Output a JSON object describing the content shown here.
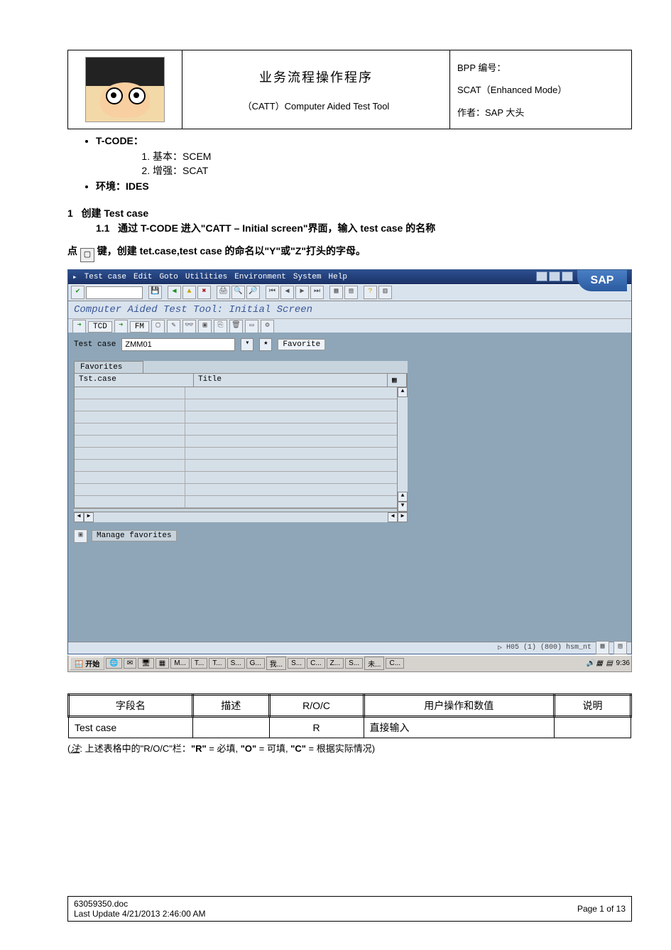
{
  "header": {
    "title_cn": "业务流程操作程序",
    "title_en": "（CATT）Computer Aided Test Tool",
    "bpp_label": "BPP 编号：",
    "scat": "SCAT（Enhanced Mode）",
    "author": "作者：SAP 大头"
  },
  "bullets": {
    "tcode": "T-CODE：",
    "tcode_items": [
      "基本：SCEM",
      "增强：SCAT"
    ],
    "env": "环境：IDES"
  },
  "section": {
    "num": "1",
    "title": "创建 Test case",
    "sub_num": "1.1",
    "sub_text": "通过 T-CODE 进入\"CATT – Initial screen\"界面，输入 test case 的名称",
    "para_before": "点",
    "para_after": "键，创建 tet.case,test case 的命名以\"Y\"或\"Z\"打头的字母。"
  },
  "sap": {
    "menu": [
      "Test case",
      "Edit",
      "Goto",
      "Utilities",
      "Environment",
      "System",
      "Help"
    ],
    "logo": "SAP",
    "screen_title": "Computer Aided Test Tool: Initial Screen",
    "tb2": [
      "TCD",
      "FM"
    ],
    "tc_label": "Test case",
    "tc_value": "ZMM01",
    "fav_btn": "Favorite",
    "fav_label": "Favorites",
    "col1": "Tst.case",
    "col2": "Title",
    "manage": "Manage favorites",
    "status": "H05 (1) (800)   hsm_nt",
    "taskbar_start": "开始",
    "taskbar_items": [
      "M...",
      "T...",
      "T...",
      "S...",
      "G...",
      "我...",
      "S...",
      "C...",
      "Z...",
      "S...",
      "未...",
      "C..."
    ],
    "clock": "9:36"
  },
  "table": {
    "h": [
      "字段名",
      "描述",
      "R/O/C",
      "用户操作和数值",
      "说明"
    ],
    "row": [
      "Test case",
      "",
      "R",
      "直接输入",
      ""
    ]
  },
  "note": "(注：上述表格中的\"R/O/C\"栏：\"R\" = 必填, \"O\" = 可填, \"C\" = 根据实际情况)",
  "footer": {
    "file": "63059350.doc",
    "update": "Last Update 4/21/2013 2:46:00 AM",
    "page": "Page 1 of 13"
  }
}
